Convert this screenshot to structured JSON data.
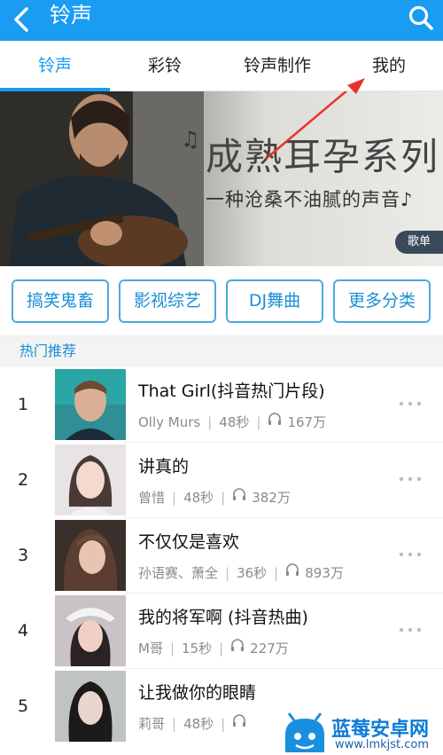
{
  "header": {
    "title": "铃声",
    "back_icon": "back-arrow-icon",
    "search_icon": "search-icon",
    "color": "#1a9cf2"
  },
  "tabs": [
    {
      "label": "铃声",
      "active": true
    },
    {
      "label": "彩铃",
      "active": false
    },
    {
      "label": "铃声制作",
      "active": false
    },
    {
      "label": "我的",
      "active": false
    }
  ],
  "banner": {
    "title": "成熟耳孕系列",
    "subtitle": "一种沧桑不油腻的声音♪",
    "note_icon": "♫",
    "badge": "歌单"
  },
  "categories": [
    "搞笑鬼畜",
    "影视综艺",
    "DJ舞曲",
    "更多分类"
  ],
  "section": {
    "title": "热门推荐"
  },
  "songs": [
    {
      "rank": "1",
      "title": "That Girl(抖音热门片段)",
      "artist": "Olly Murs",
      "duration": "48秒",
      "plays": "167万"
    },
    {
      "rank": "2",
      "title": "讲真的",
      "artist": "曾惜",
      "duration": "48秒",
      "plays": "382万"
    },
    {
      "rank": "3",
      "title": "不仅仅是喜欢",
      "artist": "孙语赛、萧全",
      "duration": "36秒",
      "plays": "893万"
    },
    {
      "rank": "4",
      "title": "我的将军啊 (抖音热曲)",
      "artist": "M哥",
      "duration": "15秒",
      "plays": "227万"
    },
    {
      "rank": "5",
      "title": "让我做你的眼睛",
      "artist": "莉哥",
      "duration": "48秒",
      "plays": ""
    }
  ],
  "watermark": {
    "name": "蓝莓安卓网",
    "url": "www.lmkjst.com"
  }
}
